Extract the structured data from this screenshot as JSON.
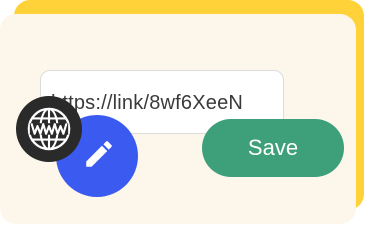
{
  "link_field": {
    "value": "https://link/8wf6XeeN"
  },
  "actions": {
    "save_label": "Save"
  },
  "icons": {
    "globe": "globe-www-icon",
    "edit": "pencil-edit-icon"
  },
  "colors": {
    "accent_yellow": "#ffd23a",
    "card_background": "#fdf6ea",
    "save_green": "#3da07a",
    "edit_blue": "#3b5bf0",
    "globe_dark": "#2a2a2a"
  }
}
